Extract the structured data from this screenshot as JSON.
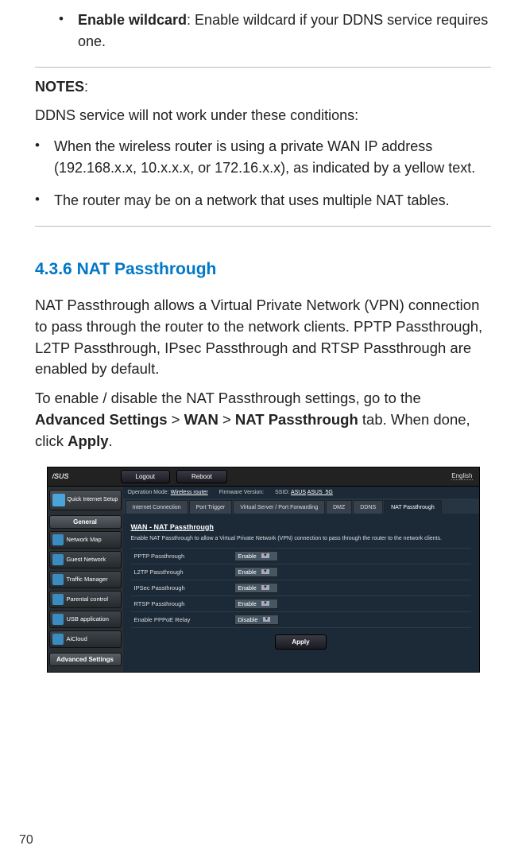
{
  "doc": {
    "bullet1_bold": "Enable wildcard",
    "bullet1_rest": ": Enable wildcard if your DDNS service requires one.",
    "notes_label": "NOTES",
    "notes_colon": ":",
    "notes_intro": "DDNS service will not work under these conditions:",
    "note_item1": "When the wireless router is using a private WAN IP address (192.168.x.x, 10.x.x.x, or 172.16.x.x), as indicated by a yellow text.",
    "note_item2": "The router may be on a network that uses multiple NAT tables.",
    "section_num": "4.3.6",
    "section_title": "NAT Passthrough",
    "para1": "NAT Passthrough allows a Virtual Private Network (VPN) connection to pass through the router to the network clients. PPTP Passthrough, L2TP Passthrough, IPsec Passthrough and RTSP Passthrough are enabled by default.",
    "para2_pre": "To enable / disable the NAT Passthrough settings, go to the ",
    "para2_b1": "Advanced Settings",
    "para2_gt1": " > ",
    "para2_b2": "WAN",
    "para2_gt2": " > ",
    "para2_b3": "NAT Passthrough",
    "para2_mid": " tab. When done, click ",
    "para2_b4": "Apply",
    "para2_end": ".",
    "page_number": "70"
  },
  "ui": {
    "logo": "/SUS",
    "top_btn_logout": "Logout",
    "top_btn_reboot": "Reboot",
    "language": "English",
    "quick_setup": "Quick Internet Setup",
    "info_mode_label": "Operation Mode:",
    "info_mode_value": "Wireless router",
    "info_fw_label": "Firmware Version:",
    "info_ssid_label": "SSID:",
    "info_ssid_v1": "ASUS",
    "info_ssid_v2": "ASUS_5G",
    "sidebar_general": "General",
    "sidebar_items": [
      "Network Map",
      "Guest Network",
      "Traffic Manager",
      "Parental control",
      "USB application",
      "AiCloud"
    ],
    "sidebar_advanced": "Advanced Settings",
    "tabs": [
      "Internet Connection",
      "Port Trigger",
      "Virtual Server / Port Forwarding",
      "DMZ",
      "DDNS",
      "NAT Passthrough"
    ],
    "active_tab_index": 5,
    "panel_title": "WAN - NAT Passthrough",
    "panel_desc": "Enable NAT Passthrough to allow a Virtual Private Network (VPN) connection to pass through the router to the network clients.",
    "settings": [
      {
        "label": "PPTP Passthrough",
        "value": "Enable"
      },
      {
        "label": "L2TP Passthrough",
        "value": "Enable"
      },
      {
        "label": "IPSec Passthrough",
        "value": "Enable"
      },
      {
        "label": "RTSP Passthrough",
        "value": "Enable"
      },
      {
        "label": "Enable PPPoE Relay",
        "value": "Disable"
      }
    ],
    "apply_label": "Apply"
  }
}
